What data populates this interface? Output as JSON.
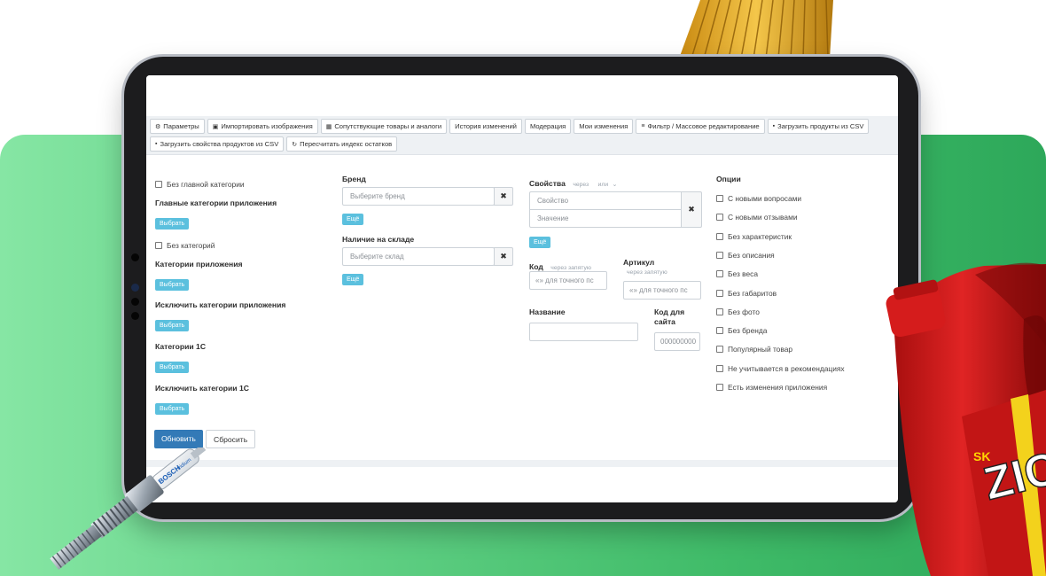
{
  "toolbar": {
    "row1": [
      {
        "icon": "gear-icon",
        "glyph": "⚙",
        "label": "Параметры"
      },
      {
        "icon": "image-icon",
        "glyph": "▣",
        "label": "Импортировать изображения"
      },
      {
        "icon": "grid-icon",
        "glyph": "▦",
        "label": "Сопутствующие товары и аналоги"
      },
      {
        "icon": "",
        "glyph": "",
        "label": "История изменений"
      },
      {
        "icon": "",
        "glyph": "",
        "label": "Модерация"
      },
      {
        "icon": "",
        "glyph": "",
        "label": "Мои изменения"
      },
      {
        "icon": "list-icon",
        "glyph": "≡",
        "label": "Фильтр / Массовое редактирование"
      },
      {
        "icon": "file-icon",
        "glyph": "▪",
        "label": "Загрузить продукты из CSV"
      }
    ],
    "row2": [
      {
        "icon": "file-icon",
        "glyph": "▪",
        "label": "Загрузить свойства продуктов из CSV"
      },
      {
        "icon": "refresh-icon",
        "glyph": "↻",
        "label": "Пересчитать индекс остатков"
      }
    ]
  },
  "categories": {
    "no_main_category": "Без главной категории",
    "main_app_categories": "Главные категории приложения",
    "select": "Выбрать",
    "no_categories": "Без категорий",
    "app_categories": "Категории приложения",
    "exclude_app_categories": "Исключить категории приложения",
    "categories_1c": "Категории 1С",
    "exclude_categories_1c": "Исключить категории 1С"
  },
  "brand": {
    "label": "Бренд",
    "placeholder": "Выберите бренд",
    "more": "Ещё"
  },
  "stock": {
    "label": "Наличие на складе",
    "placeholder": "Выберите склад",
    "more": "Ещё"
  },
  "properties": {
    "label": "Свойства",
    "hint_through": "через",
    "hint_or": "или",
    "property_placeholder": "Свойство",
    "value_placeholder": "Значение",
    "more": "Ещё"
  },
  "code": {
    "label": "Код",
    "hint": "через запятую",
    "placeholder": "«» для точного пс"
  },
  "article": {
    "label": "Артикул",
    "hint": "через запятую",
    "placeholder": "«» для точного пс"
  },
  "name": {
    "label": "Название",
    "value": ""
  },
  "site_code": {
    "label_line1": "Код для",
    "label_line2": "сайта",
    "placeholder": "000000000"
  },
  "options": {
    "label": "Опции",
    "items": [
      "С новыми вопросами",
      "С новыми отзывами",
      "Без характеристик",
      "Без описания",
      "Без веса",
      "Без габаритов",
      "Без фото",
      "Без бренда",
      "Популярный товар",
      "Не учитывается в рекомендациях",
      "Есть изменения приложения"
    ]
  },
  "actions": {
    "update": "Обновить",
    "reset": "Сбросить"
  },
  "decor": {
    "spark_plug_text": "BOSCH",
    "spark_plug_sub": "Iridium",
    "oil_brand": "SK",
    "oil_name": "ZIC"
  },
  "colors": {
    "primary": "#337ab7",
    "info": "#5bc0de",
    "green_bg": "#3fbb68"
  }
}
